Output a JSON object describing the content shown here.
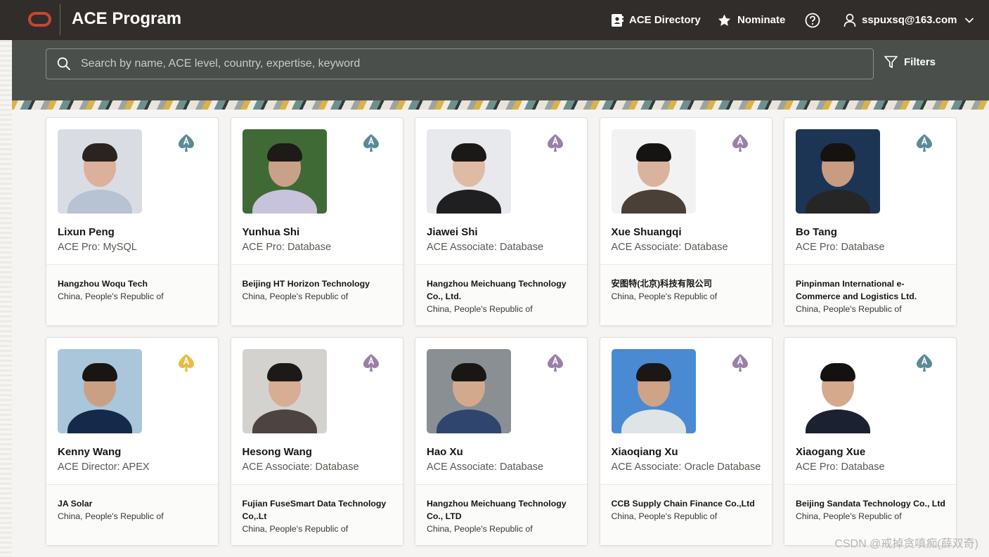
{
  "header": {
    "title": "ACE Program",
    "directory_label": "ACE Directory",
    "nominate_label": "Nominate",
    "user_email": "sspuxsq@163.com"
  },
  "search": {
    "placeholder": "Search by name, ACE level, country, expertise, keyword",
    "value": "",
    "filters_label": "Filters"
  },
  "colors": {
    "pro": "#5a8a98",
    "associate": "#9a7fa8",
    "director": "#e6bd43"
  },
  "cards": [
    {
      "name": "Lixun Peng",
      "level": "ACE Pro: MySQL",
      "badge": "pro",
      "company": "Hangzhou Woqu Tech",
      "country": "China, People's Republic of",
      "photo": {
        "bg": "#d9dde3",
        "skin": "#dcb09a",
        "hair": "#2a2320",
        "shirt": "#b7c2d3"
      }
    },
    {
      "name": "Yunhua Shi",
      "level": "ACE Pro: Database",
      "badge": "pro",
      "company": "Beijing HT Horizon Technology",
      "country": "China, People's Republic of",
      "photo": {
        "bg": "#3f6a35",
        "skin": "#c9a188",
        "hair": "#1d1a18",
        "shirt": "#c8c3dc"
      }
    },
    {
      "name": "Jiawei Shi",
      "level": "ACE Associate: Database",
      "badge": "associate",
      "company": "Hangzhou Meichuang Technology Co., Ltd.",
      "country": "China, People's Republic of",
      "photo": {
        "bg": "#e8e9ec",
        "skin": "#e0bba4",
        "hair": "#1b1917",
        "shirt": "#1f1f22"
      }
    },
    {
      "name": "Xue Shuangqi",
      "level": "ACE Associate: Database",
      "badge": "associate",
      "company": "安图特(北京)科技有限公司",
      "country": "China, People's Republic of",
      "photo": {
        "bg": "#f2f2f2",
        "skin": "#d9b39b",
        "hair": "#161412",
        "shirt": "#4a4038"
      }
    },
    {
      "name": "Bo Tang",
      "level": "ACE Pro: Database",
      "badge": "pro",
      "company": "Pinpinman International e-Commerce and Logistics Ltd.",
      "country": "China, People's Republic of",
      "photo": {
        "bg": "#1c3555",
        "skin": "#c89c80",
        "hair": "#15120f",
        "shirt": "#262626"
      }
    },
    {
      "name": "Kenny Wang",
      "level": "ACE Director: APEX",
      "badge": "director",
      "company": "JA Solar",
      "country": "China, People's Republic of",
      "photo": {
        "bg": "#a9c6db",
        "skin": "#caa085",
        "hair": "#181512",
        "shirt": "#152a4a"
      }
    },
    {
      "name": "Hesong Wang",
      "level": "ACE Associate: Database",
      "badge": "associate",
      "company": "Fujian FuseSmart Data Technology Co,.Lt",
      "country": "China, People's Republic of",
      "photo": {
        "bg": "#d4d2cf",
        "skin": "#d7ad93",
        "hair": "#1c1917",
        "shirt": "#4d4340"
      }
    },
    {
      "name": "Hao Xu",
      "level": "ACE Associate: Database",
      "badge": "associate",
      "company": "Hangzhou Meichuang Technology Co., LTD",
      "country": "China, People's Republic of",
      "photo": {
        "bg": "#8a8f94",
        "skin": "#d3a98e",
        "hair": "#191714",
        "shirt": "#2f456e"
      }
    },
    {
      "name": "Xiaoqiang Xu",
      "level": "ACE Associate: Oracle Database",
      "badge": "associate",
      "company": "CCB Supply Chain Finance Co.,Ltd",
      "country": "China, People's Republic of",
      "photo": {
        "bg": "#4a8ad3",
        "skin": "#cfa387",
        "hair": "#1a1714",
        "shirt": "#dfe4e6"
      }
    },
    {
      "name": "Xiaogang Xue",
      "level": "ACE Pro: Database",
      "badge": "pro",
      "company": "Beijing Sandata Technology Co., Ltd",
      "country": "China, People's Republic of",
      "photo": {
        "bg": "#ffffff",
        "skin": "#d4a98c",
        "hair": "#141210",
        "shirt": "#1b2130"
      }
    }
  ],
  "watermark": "CSDN @戒掉贪嗔痴(薛双奇)"
}
